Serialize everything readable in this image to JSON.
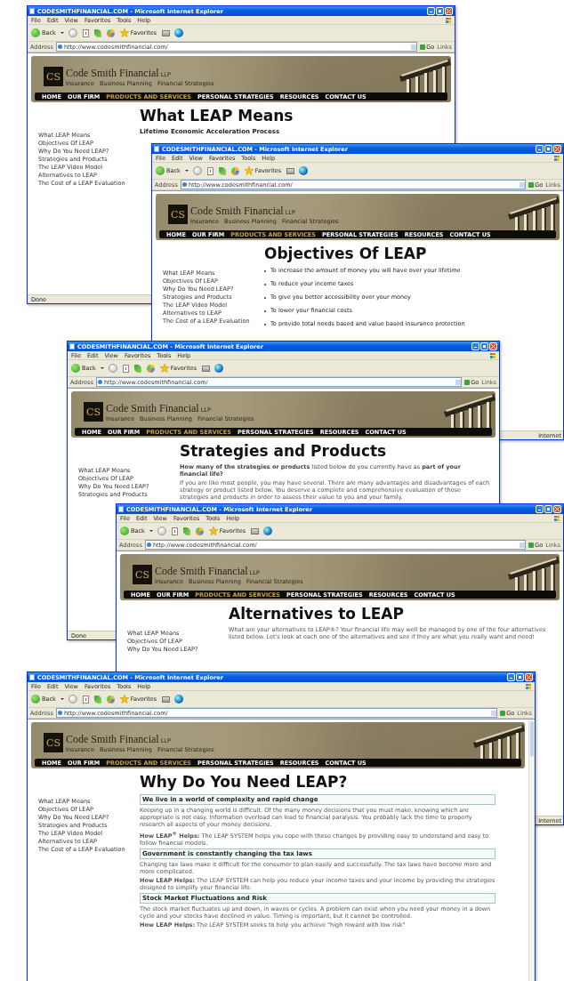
{
  "windows": [
    {
      "title": "CODESMITHFINANCIAL.COM - Microsoft Internet Explorer",
      "menu": [
        "File",
        "Edit",
        "View",
        "Favorites",
        "Tools",
        "Help"
      ],
      "toolbar": {
        "back": "Back",
        "favorites": "Favorites"
      },
      "address": {
        "label": "Address",
        "url": "http://www.codesmithfinancial.com/",
        "go": "Go",
        "links": "Links"
      },
      "site": {
        "monogram": "CS",
        "name": "Code Smith Financial",
        "suffix": "LLP",
        "tagline": "Insurance   Business Planning   Financial Strategies",
        "nav": [
          {
            "label": "HOME",
            "selected": false
          },
          {
            "label": "OUR FIRM",
            "selected": false
          },
          {
            "label": "PRODUCTS AND SERVICES",
            "selected": true
          },
          {
            "label": "PERSONAL STRATEGIES",
            "selected": false
          },
          {
            "label": "RESOURCES",
            "selected": false
          },
          {
            "label": "CONTACT US",
            "selected": false
          }
        ]
      },
      "heading": "What LEAP Means",
      "sidebar": [
        "What LEAP Means",
        "Objectives Of LEAP",
        "Why Do You Need LEAP?",
        "Strategies and Products",
        "The LEAP Video Model",
        "Alternatives to LEAP",
        "The Cost of a LEAP Evaluation"
      ],
      "blocks": [
        {
          "kind": "subtitle",
          "text": "Lifetime Economic Acceleration Process"
        }
      ],
      "status": {
        "message": "Done"
      }
    },
    {
      "title": "CODESMITHFINANCIAL.COM - Microsoft Internet Explorer",
      "menu": [
        "File",
        "Edit",
        "View",
        "Favorites",
        "Tools",
        "Help"
      ],
      "toolbar": {
        "back": "Back",
        "favorites": "Favorites"
      },
      "address": {
        "label": "Address",
        "url": "http://www.codesmithfinancial.com/",
        "go": "Go",
        "links": "Links"
      },
      "site": {
        "monogram": "CS",
        "name": "Code Smith Financial",
        "suffix": "LLP",
        "tagline": "Insurance   Business Planning   Financial Strategies",
        "nav": [
          {
            "label": "HOME",
            "selected": false
          },
          {
            "label": "OUR FIRM",
            "selected": false
          },
          {
            "label": "PRODUCTS AND SERVICES",
            "selected": true
          },
          {
            "label": "PERSONAL STRATEGIES",
            "selected": false
          },
          {
            "label": "RESOURCES",
            "selected": false
          },
          {
            "label": "CONTACT US",
            "selected": false
          }
        ]
      },
      "heading": "Objectives Of LEAP",
      "sidebar": [
        "What LEAP Means",
        "Objectives Of LEAP",
        "Why Do You Need LEAP?",
        "Strategies and Products",
        "The LEAP Video Model",
        "Alternatives to LEAP",
        "The Cost of a LEAP Evaluation"
      ],
      "blocks": [
        {
          "kind": "bullets",
          "items": [
            "To increase the amount of money you will have over your lifetime",
            "To reduce your income taxes",
            "To give you better accessibility over your money",
            "To lower your financial costs",
            "To provide total needs based and value based insurance protection"
          ]
        }
      ],
      "status": {
        "zone": "Internet"
      }
    },
    {
      "title": "CODESMITHFINANCIAL.COM - Microsoft Internet Explorer",
      "menu": [
        "File",
        "Edit",
        "View",
        "Favorites",
        "Tools",
        "Help"
      ],
      "toolbar": {
        "back": "Back",
        "favorites": "Favorites"
      },
      "address": {
        "label": "Address",
        "url": "http://www.codesmithfinancial.com/",
        "go": "Go",
        "links": "Links"
      },
      "site": {
        "monogram": "CS",
        "name": "Code Smith Financial",
        "suffix": "LLP",
        "tagline": "Insurance   Business Planning   Financial Strategies",
        "nav": [
          {
            "label": "HOME",
            "selected": false
          },
          {
            "label": "OUR FIRM",
            "selected": false
          },
          {
            "label": "PRODUCTS AND SERVICES",
            "selected": true
          },
          {
            "label": "PERSONAL STRATEGIES",
            "selected": false
          },
          {
            "label": "RESOURCES",
            "selected": false
          },
          {
            "label": "CONTACT US",
            "selected": false
          }
        ]
      },
      "heading": "Strategies and Products",
      "sidebar": [
        "What LEAP Means",
        "Objectives Of LEAP",
        "Why Do You Need LEAP?",
        "Strategies and Products"
      ],
      "blocks": [
        {
          "kind": "lead",
          "text": "**How many of the strategies or products** listed below do you currently have as **part of your financial life?**"
        },
        {
          "kind": "paragraph",
          "text": "If you are like most people, you may have several. There are many advantages and disadvantages of each strategy or product listed below. You deserve a complete and comprehensive evaluation of those strategies and products in order to assess their value to you and your family."
        }
      ],
      "status": {
        "message": "Done"
      }
    },
    {
      "title": "CODESMITHFINANCIAL.COM - Microsoft Internet Explorer",
      "menu": [
        "File",
        "Edit",
        "View",
        "Favorites",
        "Tools",
        "Help"
      ],
      "toolbar": {
        "back": "Back",
        "favorites": "Favorites"
      },
      "address": {
        "label": "Address",
        "url": "http://www.codesmithfinancial.com/",
        "go": "Go",
        "links": "Links"
      },
      "site": {
        "monogram": "CS",
        "name": "Code Smith Financial",
        "suffix": "LLP",
        "tagline": "Insurance   Business Planning   Financial Strategies",
        "nav": [
          {
            "label": "HOME",
            "selected": false
          },
          {
            "label": "OUR FIRM",
            "selected": false
          },
          {
            "label": "PRODUCTS AND SERVICES",
            "selected": true
          },
          {
            "label": "PERSONAL STRATEGIES",
            "selected": false
          },
          {
            "label": "RESOURCES",
            "selected": false
          },
          {
            "label": "CONTACT US",
            "selected": false
          }
        ]
      },
      "heading": "Alternatives to LEAP",
      "sidebar": [
        "What LEAP Means",
        "Objectives Of LEAP",
        "Why Do You Need LEAP?"
      ],
      "blocks": [
        {
          "kind": "paragraph",
          "text": "What are your alternatives to LEAP®? Your financial life may well be managed by one of the four alternatives listed below. Let's look at each one of the alternatives and see if they are what you really want and need!"
        }
      ],
      "status": {
        "zone": "Internet"
      }
    },
    {
      "title": "CODESMITHFINANCIAL.COM - Microsoft Internet Explorer",
      "menu": [
        "File",
        "Edit",
        "View",
        "Favorites",
        "Tools",
        "Help"
      ],
      "toolbar": {
        "back": "Back",
        "favorites": "Favorites"
      },
      "address": {
        "label": "Address",
        "url": "http://www.codesmithfinancial.com/",
        "go": "Go",
        "links": "Links"
      },
      "site": {
        "monogram": "CS",
        "name": "Code Smith Financial",
        "suffix": "LLP",
        "tagline": "Insurance   Business Planning   Financial Strategies",
        "nav": [
          {
            "label": "HOME",
            "selected": false
          },
          {
            "label": "OUR FIRM",
            "selected": false
          },
          {
            "label": "PRODUCTS AND SERVICES",
            "selected": true
          },
          {
            "label": "PERSONAL STRATEGIES",
            "selected": false
          },
          {
            "label": "RESOURCES",
            "selected": false
          },
          {
            "label": "CONTACT US",
            "selected": false
          }
        ]
      },
      "heading": "Why Do You Need LEAP?",
      "sidebar": [
        "What LEAP Means",
        "Objectives Of LEAP",
        "Why Do You Need LEAP?",
        "Strategies and Products",
        "The LEAP Video Model",
        "Alternatives to LEAP",
        "The Cost of a LEAP Evaluation"
      ],
      "blocks": [
        {
          "kind": "section",
          "heading": "We live in a world of complexity and rapid change",
          "paragraphs": [
            "Keeping up in a changing world is difficult. Of the many money decisions that you must make, knowing which are appropriate is not easy. Information overload can lead to financial paralysis. You probably lack the time to properly research all aspects of your money decisions.",
            "**How LEAP$^{®}$ Helps:** The LEAP SYSTEM helps you cope with these changes by providing easy to understand and easy to follow financial models."
          ]
        },
        {
          "kind": "section",
          "heading": "Government is constantly changing the tax laws",
          "paragraphs": [
            "Changing tax laws make it difficult for the consumer to plan easily and successfully. The tax laws have become more and more complicated.",
            "**How LEAP Helps:** The LEAP SYSTEM can help you reduce your income taxes and your income by providing the strategies designed to simplify your financial life."
          ]
        },
        {
          "kind": "section",
          "heading": "Stock Market Fluctuations and Risk",
          "paragraphs": [
            "The stock market fluctuates up and down, in waves or cycles. A problem can exist when you need your money in a down cycle and your stocks have declined in value. Timing is important, but it cannot be controlled.",
            "**How LEAP Helps:** The LEAP SYSTEM seeks to help you achieve \"high reward with low risk\""
          ]
        }
      ]
    }
  ]
}
